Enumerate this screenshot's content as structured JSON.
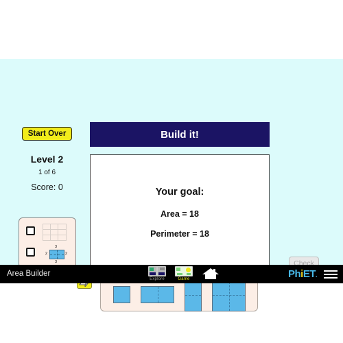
{
  "app": {
    "sim_title": "Area Builder",
    "brand": "PhET",
    "brand_colors": {
      "primary": "#48b8e8",
      "accent": "#f2d11b",
      "navbar_bg": "#000000"
    }
  },
  "sim": {
    "background_color": "#dcfbfb",
    "start_over_label": "Start Over",
    "level_label": "Level 2",
    "level_progress": "1 of 6",
    "score_label": "Score: 0",
    "banner_title": "Build it!",
    "banner_color": "#1b1464",
    "check_label": "Check",
    "check_enabled": false
  },
  "goal": {
    "title": "Your goal:",
    "lines": [
      "Area = 18",
      "Perimeter = 18"
    ],
    "area": 18,
    "perimeter": 18
  },
  "controls": {
    "checkboxes": [
      {
        "name": "grid-checkbox",
        "icon": "grid-icon",
        "checked": false
      },
      {
        "name": "dimensions-checkbox",
        "icon": "dimensions-icon",
        "checked": false
      }
    ],
    "dimension_icon_labels": {
      "top": "3",
      "right": "2",
      "bottom": "3",
      "left": "2"
    },
    "eraser_icon": "eraser-icon"
  },
  "carousel": {
    "shape_color": "#5bb8e8",
    "tiles": [
      {
        "name": "shape-tile-1x1",
        "cols": 1,
        "rows": 1
      },
      {
        "name": "shape-tile-2x1",
        "cols": 2,
        "rows": 1
      },
      {
        "name": "shape-tile-1x2",
        "cols": 1,
        "rows": 2
      },
      {
        "name": "shape-tile-2x2",
        "cols": 2,
        "rows": 2
      }
    ]
  },
  "navbar": {
    "items": [
      {
        "label": "Explore",
        "selected": false,
        "color": "#9a9a9a"
      },
      {
        "label": "Game",
        "selected": true,
        "color": "#e8e81b"
      }
    ],
    "home_icon": "home-icon",
    "menu_icon": "hamburger-menu-icon"
  }
}
